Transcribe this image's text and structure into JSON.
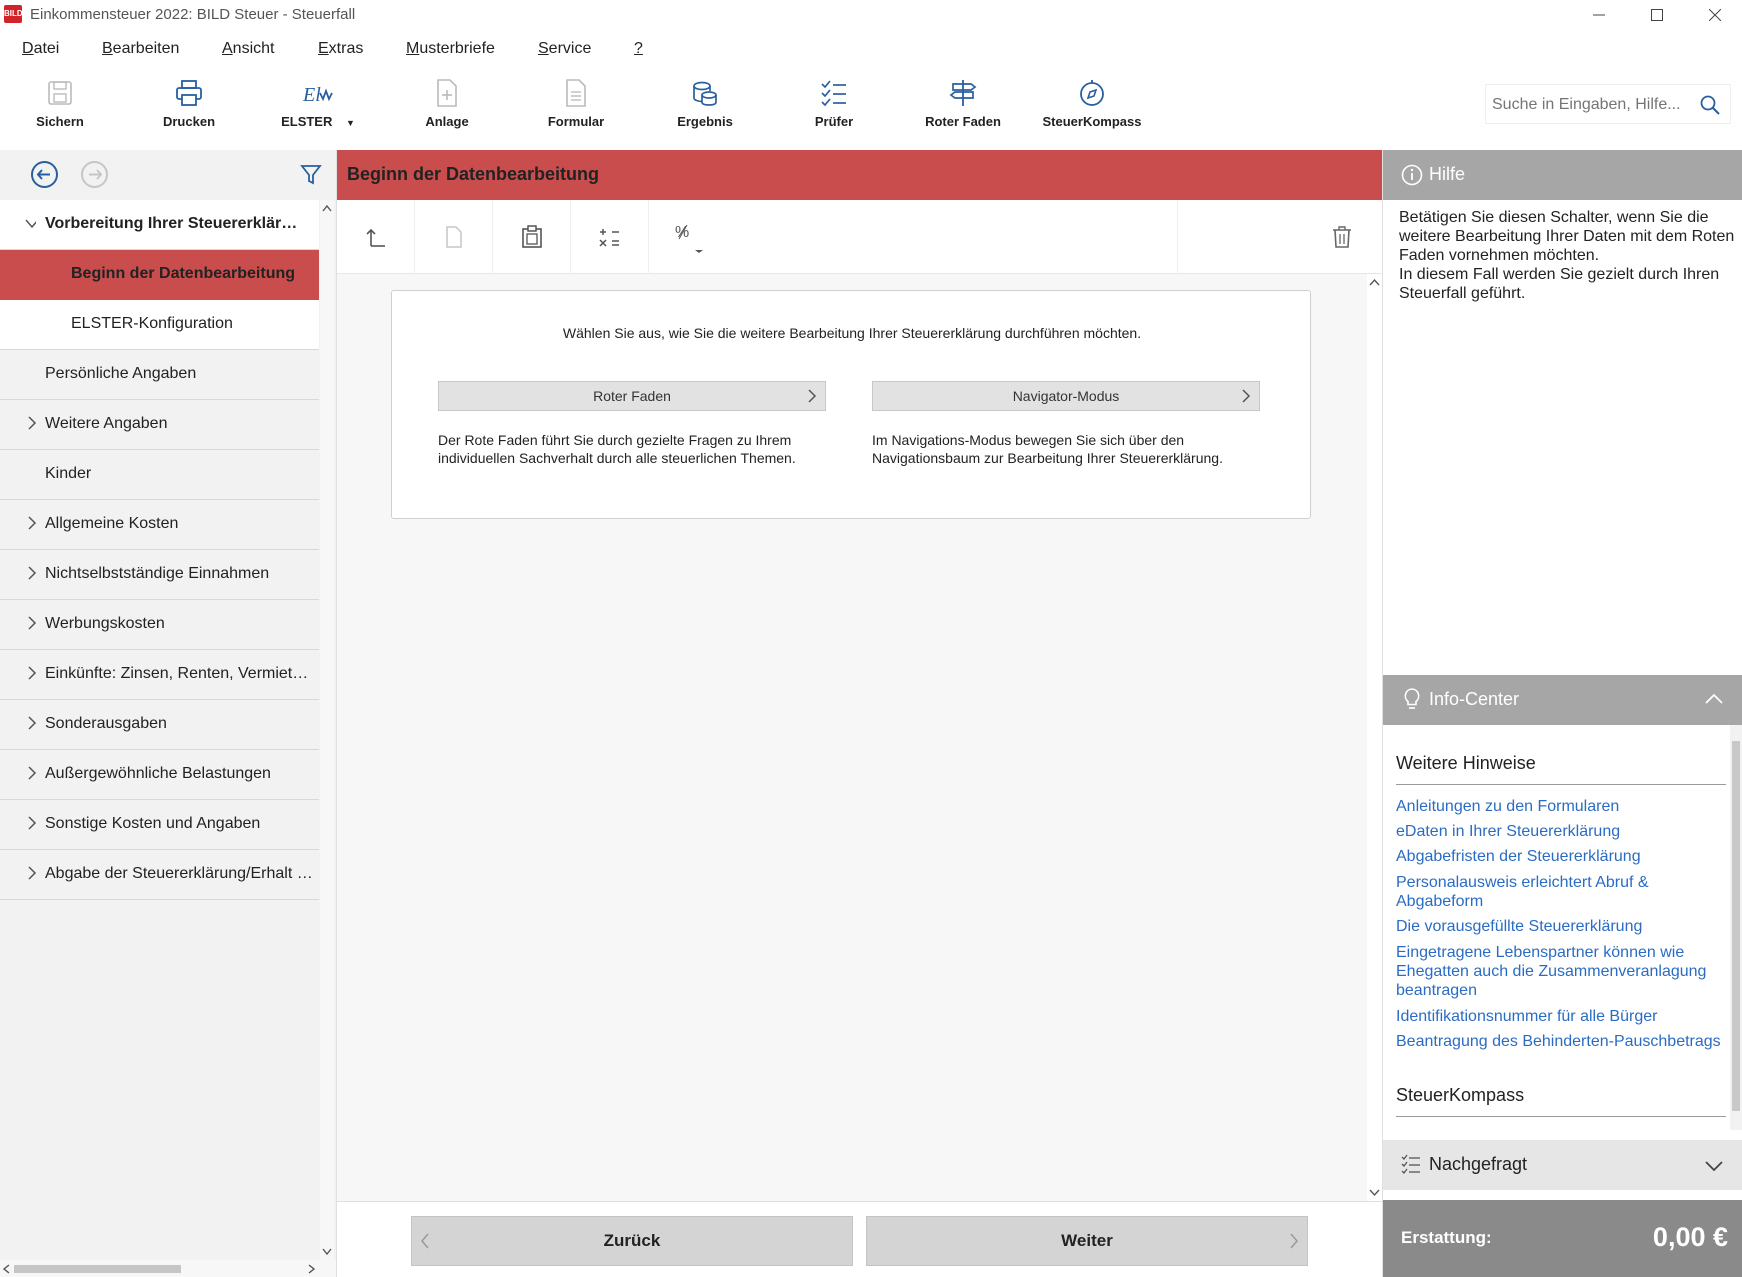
{
  "window": {
    "logo_text": "BILD",
    "title": "Einkommensteuer 2022: BILD Steuer - Steuerfall"
  },
  "menu": [
    {
      "accel": "D",
      "rest": "atei"
    },
    {
      "accel": "B",
      "rest": "earbeiten"
    },
    {
      "accel": "A",
      "rest": "nsicht"
    },
    {
      "accel": "E",
      "rest": "xtras"
    },
    {
      "accel": "M",
      "rest": "usterbriefe"
    },
    {
      "accel": "S",
      "rest": "ervice"
    },
    {
      "accel": "?",
      "rest": ""
    }
  ],
  "toolbar": {
    "buttons": [
      {
        "label": "Sichern",
        "icon": "save-icon"
      },
      {
        "label": "Drucken",
        "icon": "print-icon"
      },
      {
        "label": "ELSTER",
        "icon": "elster-icon"
      },
      {
        "label": "Anlage",
        "icon": "add-document-icon"
      },
      {
        "label": "Formular",
        "icon": "form-icon"
      },
      {
        "label": "Ergebnis",
        "icon": "coins-icon"
      },
      {
        "label": "Prüfer",
        "icon": "checklist-icon"
      },
      {
        "label": "Roter Faden",
        "icon": "signpost-icon"
      },
      {
        "label": "SteuerKompass",
        "icon": "compass-icon"
      }
    ],
    "search_placeholder": "Suche in Eingaben, Hilfe..."
  },
  "nav": {
    "items": [
      {
        "label": "Vorbereitung Ihrer Steuererklär…",
        "expanded": true
      },
      {
        "label": "Beginn der Datenbearbeitung",
        "selected": true
      },
      {
        "label": "ELSTER-Konfiguration"
      },
      {
        "label": "Persönliche Angaben"
      },
      {
        "label": "Weitere Angaben"
      },
      {
        "label": "Kinder"
      },
      {
        "label": "Allgemeine Kosten"
      },
      {
        "label": "Nichtselbstständige Einnahmen"
      },
      {
        "label": "Werbungskosten"
      },
      {
        "label": "Einkünfte: Zinsen, Renten, Vermietu…"
      },
      {
        "label": "Sonderausgaben"
      },
      {
        "label": "Außergewöhnliche Belastungen"
      },
      {
        "label": "Sonstige Kosten und Angaben"
      },
      {
        "label": "Abgabe der Steuererklärung/Erhalt d…"
      }
    ]
  },
  "center": {
    "title": "Beginn der Datenbearbeitung",
    "intro": "Wählen Sie aus, wie Sie die weitere Bearbeitung Ihrer Steuererklärung durchführen möchten.",
    "options": [
      {
        "label": "Roter Faden",
        "description": "Der Rote Faden führt Sie durch gezielte Fragen zu Ihrem individuellen Sachverhalt durch alle steuerlichen Themen."
      },
      {
        "label": "Navigator-Modus",
        "description": "Im Navigations-Modus bewegen Sie sich über den Navigationsbaum zur Bearbeitung Ihrer Steuererklärung."
      }
    ],
    "back_label": "Zurück",
    "next_label": "Weiter"
  },
  "help": {
    "title": "Hilfe",
    "text": "Betätigen Sie diesen Schalter, wenn Sie die weitere Bearbeitung Ihrer Daten mit dem Roten Faden vornehmen möchten.\nIn diesem Fall werden Sie gezielt durch Ihren Steuerfall geführt."
  },
  "info_center": {
    "title": "Info-Center",
    "section1": "Weitere Hinweise",
    "links": [
      "Anleitungen zu den Formularen",
      "eDaten in Ihrer Steuererklärung",
      "Abgabefristen der Steuererklärung",
      "Personalausweis erleichtert Abruf & Abgabeform",
      "Die vorausgefüllte Steuererklärung",
      "Eingetragene Lebenspartner können wie Ehegatten auch die Zusammenveranlagung beantragen",
      "Identifikationsnummer für alle Bürger",
      "Beantragung des Behinderten-Pauschbetrags"
    ],
    "section2": "SteuerKompass"
  },
  "nachgefragt": {
    "title": "Nachgefragt"
  },
  "refund": {
    "label": "Erstattung:",
    "value": "0,00 €"
  },
  "colors": {
    "accent_red": "#c94d4d",
    "link_blue": "#2a6cc4",
    "panel_gray": "#a6a6a6"
  }
}
